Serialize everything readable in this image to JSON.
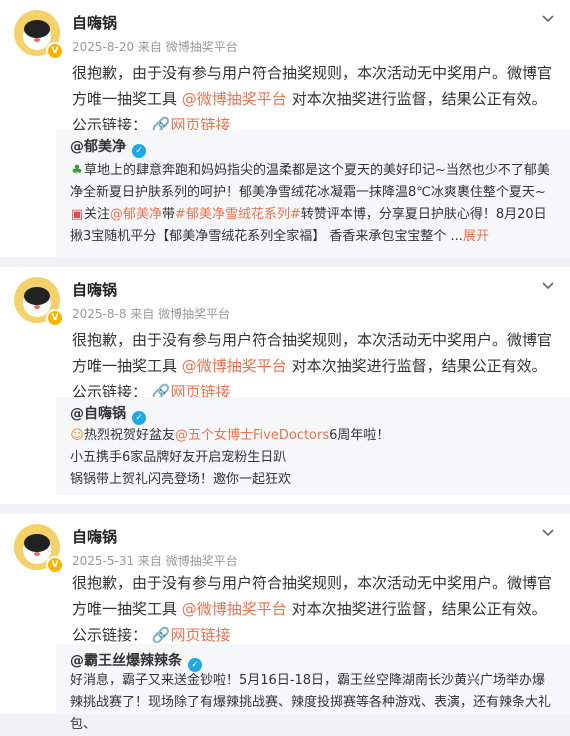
{
  "posts": [
    {
      "author": "自嗨锅",
      "meta": "2025-8-20 来自 微博抽奖平台",
      "body_prefix": "很抱歉，由于没有参与用户符合抽奖规则，本次活动无中奖用户。微博官方唯一抽奖工具",
      "mention": "@微博抽奖平台",
      "body_mid": "对本次抽奖进行监督，结果公正有效。公示链接：",
      "link": "网页链接",
      "quote": {
        "author": "@郁美净",
        "line1_icon": "tree-icon",
        "line1": "草地上的肆意奔跑和妈妈指尖的温柔都是这个夏天的美好印记~当然也少不了郁美净全新夏日护肤系列的呵护！郁美净雪绒花冰凝霜一抹降温8℃冰爽裹住整个夏天~",
        "line2_icon": "gift-icon",
        "line2_prefix": "关注",
        "line2_mention": "@郁美净",
        "line2_mid": "带",
        "line2_topic": "#郁美净雪绒花系列#",
        "line2_rest": "转赞评本博，分享夏日护肤心得！8月20日揪3宝随机平分【郁美净雪绒花系列全家福】 香香来承包宝宝整个 ...",
        "expand": "展开"
      }
    },
    {
      "author": "自嗨锅",
      "meta": "2025-8-8 来自 微博抽奖平台",
      "body_prefix": "很抱歉，由于没有参与用户符合抽奖规则，本次活动无中奖用户。微博官方唯一抽奖工具",
      "mention": "@微博抽奖平台",
      "body_mid": "对本次抽奖进行监督，结果公正有效。公示链接：",
      "link": "网页链接",
      "quote": {
        "author": "@自嗨锅",
        "line1_icon": "smile-icon",
        "line1_prefix": "热烈祝贺好盆友",
        "line1_mention": "@五个女博士FiveDoctors",
        "line1_rest": "6周年啦！",
        "line2": "小五携手6家品牌好友开启宠粉生日趴",
        "line3": "锅锅带上贺礼闪亮登场！邀你一起狂欢"
      }
    },
    {
      "author": "自嗨锅",
      "meta": "2025-5-31 来自 微博抽奖平台",
      "body_prefix": "很抱歉，由于没有参与用户符合抽奖规则，本次活动无中奖用户。微博官方唯一抽奖工具",
      "mention": "@微博抽奖平台",
      "body_mid": "对本次抽奖进行监督，结果公正有效。公示链接：",
      "link": "网页链接",
      "quote": {
        "author": "@霸王丝爆辣辣条",
        "line1": "好消息，霸子又来送金钞啦！5月16日-18日，霸王丝空降湖南长沙黄兴广场举办爆辣挑战赛了！现场除了有爆辣挑战赛、辣度投掷赛等各种游戏、表演，还有辣条大礼包、"
      }
    }
  ]
}
